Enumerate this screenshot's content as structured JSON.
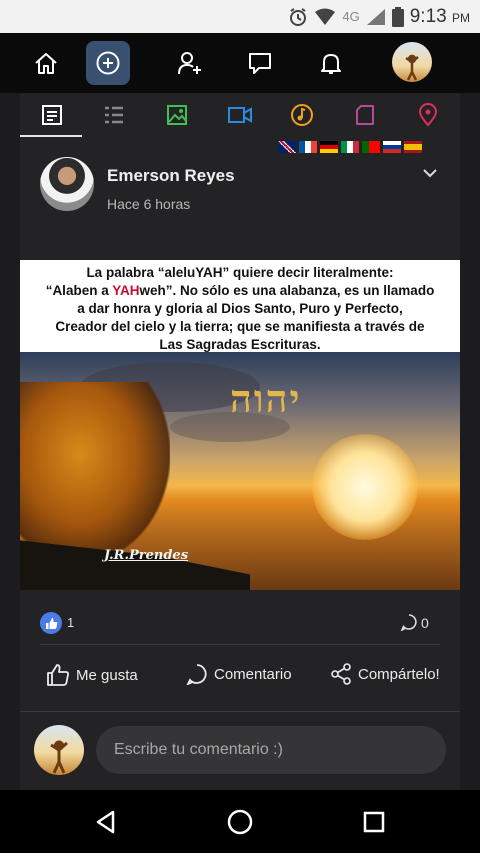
{
  "status_bar": {
    "network": "4G",
    "time": "9:13",
    "ampm": "PM"
  },
  "app_bar": {
    "icons": [
      "home-icon",
      "add-circle-icon",
      "add-user-icon",
      "messages-icon",
      "bell-icon"
    ]
  },
  "tabs": [
    "text-tab-icon",
    "list-tab-icon",
    "image-tab-icon",
    "video-tab-icon",
    "music-tab-icon",
    "file-tab-icon",
    "location-tab-icon"
  ],
  "flags": [
    "uk",
    "fr",
    "de",
    "it",
    "pt",
    "ru",
    "es"
  ],
  "post": {
    "author": "Emerson Reyes",
    "time": "Hace 6 horas",
    "image_text": {
      "line1_a": "La palabra “aleluYAH” quiere decir literalmente:",
      "line2_a": "“Alaben a ",
      "line2_yah": "YAH",
      "line2_b": "weh”. No sólo es una alabanza, es un llamado",
      "line3": "a dar honra y gloria al Dios Santo, Puro y Perfecto,",
      "line4": "Creador del cielo y la tierra; que se manifiesta a través de",
      "line5": "Las Sagradas Escrituras."
    },
    "hebrew": "יהוה",
    "signature": "J.R.Prendes",
    "likes": "1",
    "comments": "0"
  },
  "actions": {
    "like": "Me gusta",
    "comment": "Comentario",
    "share": "Compártelo!"
  },
  "comment_box": {
    "placeholder": "Escribe tu comentario :)"
  },
  "colors": {
    "accent": "#4a7be6",
    "active_bg": "#3a5070",
    "yah_red": "#c8102e"
  }
}
